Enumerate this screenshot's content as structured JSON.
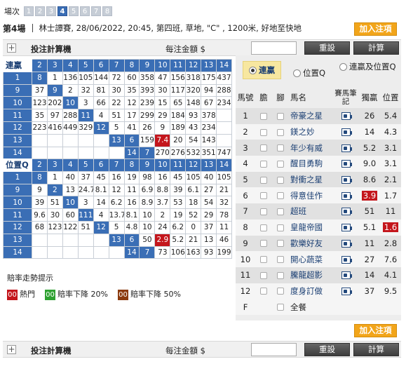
{
  "race_selector": {
    "label": "場次",
    "races": [
      "1",
      "2",
      "3",
      "4",
      "5",
      "6",
      "7",
      "8"
    ],
    "active": "4"
  },
  "race_info": {
    "race_no": "第4場",
    "detail": "林士譚賽, 28/06/2022, 20:45, 第四班, 草地, \"C\" , 1200米, 好地至快地"
  },
  "buttons": {
    "add_bet": "加入注項",
    "reset": "重設",
    "calculate": "計算"
  },
  "calculator": {
    "title": "投注計算機",
    "unit_label": "每注金額 $",
    "amount": ""
  },
  "quinella": {
    "title": "連贏",
    "col_headers": [
      "2",
      "3",
      "4",
      "5",
      "6",
      "7",
      "8",
      "9",
      "10",
      "11",
      "12",
      "13",
      "14"
    ],
    "rows": [
      {
        "h": "1",
        "c": [
          "8",
          "1",
          "136",
          "105",
          "144",
          "72",
          "60",
          "358",
          "47",
          "156",
          "318",
          "175",
          "437"
        ]
      },
      {
        "h": "9",
        "c": [
          "37",
          "9",
          "2",
          "32",
          "81",
          "30",
          "35",
          "393",
          "30",
          "117",
          "320",
          "94",
          "288"
        ]
      },
      {
        "h": "10",
        "c": [
          "123",
          "202",
          "10",
          "3",
          "66",
          "22",
          "12",
          "239",
          "15",
          "65",
          "148",
          "67",
          "234"
        ]
      },
      {
        "h": "11",
        "c": [
          "35",
          "97",
          "288",
          "11",
          "4",
          "51",
          "17",
          "299",
          "29",
          "184",
          "93",
          "378",
          ""
        ]
      },
      {
        "h": "12",
        "c": [
          "223",
          "416",
          "449",
          "329",
          "12",
          "5",
          "41",
          "26",
          "9",
          "189",
          "43",
          "234",
          ""
        ]
      },
      {
        "h": "13",
        "c": [
          "",
          "",
          "",
          "",
          "",
          "13",
          "6",
          "159",
          "7.4",
          "20",
          "54",
          "143",
          "",
          ""
        ]
      },
      {
        "h": "14",
        "c": [
          "",
          "",
          "",
          "",
          "",
          "",
          "14",
          "7",
          "270",
          "276",
          "532",
          "351",
          "747",
          ""
        ]
      }
    ]
  },
  "quinella_place": {
    "title": "位置Q",
    "col_headers": [
      "2",
      "3",
      "4",
      "5",
      "6",
      "7",
      "8",
      "9",
      "10",
      "11",
      "12",
      "13",
      "14"
    ],
    "rows": [
      {
        "h": "1",
        "c": [
          "8",
          "1",
          "40",
          "37",
          "45",
          "16",
          "19",
          "98",
          "16",
          "45",
          "105",
          "40",
          "105"
        ]
      },
      {
        "h": "9",
        "c": [
          "9",
          "2",
          "13",
          "24.7",
          "8.1",
          "12",
          "11",
          "6.9",
          "8.8",
          "39",
          "6.1",
          "27",
          "21"
        ]
      },
      {
        "h": "10",
        "c": [
          "39",
          "51",
          "10",
          "3",
          "14",
          "6.2",
          "16",
          "8.9",
          "3.7",
          "53",
          "18",
          "54",
          "32"
        ]
      },
      {
        "h": "11",
        "c": [
          "9.6",
          "30",
          "60",
          "111",
          "4",
          "13.7",
          "8.1",
          "10",
          "2",
          "19",
          "52",
          "29",
          "78"
        ]
      },
      {
        "h": "12",
        "c": [
          "68",
          "123",
          "122",
          "51",
          "12",
          "5",
          "4.8",
          "10",
          "24",
          "6.2",
          "0",
          "37",
          "11"
        ]
      },
      {
        "h": "13",
        "c": [
          "",
          "",
          "",
          "",
          "",
          "13",
          "6",
          "50",
          "2.9",
          "5.2",
          "21",
          "13",
          "46"
        ]
      },
      {
        "h": "14",
        "c": [
          "",
          "",
          "",
          "",
          "",
          "",
          "14",
          "7",
          "73",
          "106",
          "163",
          "93",
          "199"
        ]
      }
    ]
  },
  "trend": {
    "title": "賠率走勢提示",
    "legend": [
      {
        "badge": "00",
        "label": "熱門",
        "color": "#c4161c"
      },
      {
        "badge": "00",
        "label": "賠率下降 20%",
        "color": "#2ea131"
      },
      {
        "badge": "00",
        "label": "賠率下降 50%",
        "color": "#8b3a0e"
      }
    ]
  },
  "bet_types": {
    "options": [
      "連贏",
      "位置Q",
      "連贏及位置Q"
    ],
    "selected": "連贏"
  },
  "horse_table": {
    "headers": [
      "馬號",
      "膽",
      "腳",
      "馬名",
      "賽馬筆記",
      "獨贏",
      "位置"
    ],
    "rows": [
      {
        "no": "1",
        "name": "帝豪之星",
        "win": "26",
        "place": "5.4"
      },
      {
        "no": "2",
        "name": "鎂之妙",
        "win": "14",
        "place": "4.3"
      },
      {
        "no": "3",
        "name": "年少有威",
        "win": "5.2",
        "place": "3.1"
      },
      {
        "no": "4",
        "name": "醒目勇駒",
        "win": "9.0",
        "place": "3.1"
      },
      {
        "no": "5",
        "name": "對衝之星",
        "win": "8.6",
        "place": "2.1"
      },
      {
        "no": "6",
        "name": "得意佳作",
        "win": "3.9",
        "place": "1.7"
      },
      {
        "no": "7",
        "name": "超班",
        "win": "51",
        "place": "11"
      },
      {
        "no": "8",
        "name": "皇龍帝國",
        "win": "5.1",
        "place": "1.6"
      },
      {
        "no": "9",
        "name": "歡樂好友",
        "win": "11",
        "place": "2.8"
      },
      {
        "no": "10",
        "name": "開心蔬菜",
        "win": "27",
        "place": "7.6"
      },
      {
        "no": "11",
        "name": "騰龍超影",
        "win": "14",
        "place": "4.1"
      },
      {
        "no": "12",
        "name": "度身訂做",
        "win": "37",
        "place": "9.5"
      }
    ],
    "field_row": {
      "no": "F",
      "label": "全餐"
    }
  }
}
